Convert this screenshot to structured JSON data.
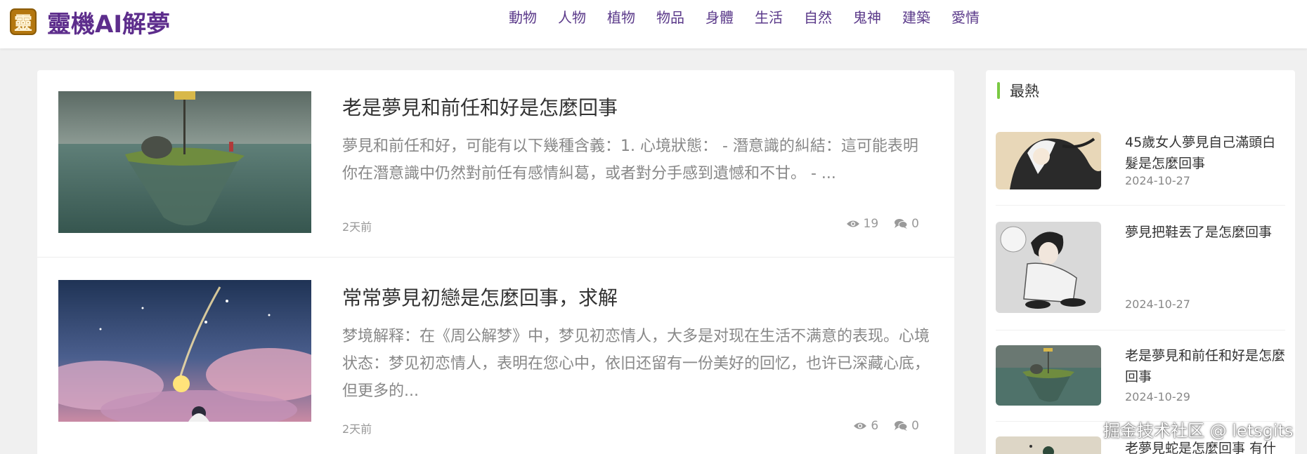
{
  "brand": {
    "icon_char": "靈",
    "name": "靈機AI解夢"
  },
  "nav": [
    "動物",
    "人物",
    "植物",
    "物品",
    "身體",
    "生活",
    "自然",
    "鬼神",
    "建築",
    "愛情"
  ],
  "posts": [
    {
      "title": "老是夢見和前任和好是怎麼回事",
      "excerpt": "夢見和前任和好，可能有以下幾種含義：1. 心境狀態： - 潛意識的糾結：這可能表明你在潛意識中仍然對前任有感情糾葛，或者對分手感到遺憾和不甘。 - ...",
      "time": "2天前",
      "views": "19",
      "comments": "0"
    },
    {
      "title": "常常夢見初戀是怎麼回事，求解",
      "excerpt": "梦境解释：在《周公解梦》中，梦见初恋情人，大多是对现在生活不满意的表现。心境状态：梦见初恋情人，表明在您心中，依旧还留有一份美好的回忆，也许已深藏心底，但更多的...",
      "time": "2天前",
      "views": "6",
      "comments": "0"
    }
  ],
  "sidebar": {
    "title": "最熱",
    "items": [
      {
        "title": "45歲女人夢見自己滿頭白髮是怎麼回事",
        "date": "2024-10-27"
      },
      {
        "title": "夢見把鞋丟了是怎麼回事",
        "date": "2024-10-27"
      },
      {
        "title": "老是夢見和前任和好是怎麼回事",
        "date": "2024-10-29"
      },
      {
        "title": "老夢見蛇是怎麼回事 有什",
        "date": ""
      }
    ]
  },
  "watermark": "掘金技术社区 @ letsgits",
  "colors": {
    "brand_purple": "#5d2d8c",
    "accent_green": "#7ac943",
    "logo_gold": "#b4770f"
  },
  "icons": {
    "views": "eye-icon",
    "comments": "comments-icon"
  }
}
